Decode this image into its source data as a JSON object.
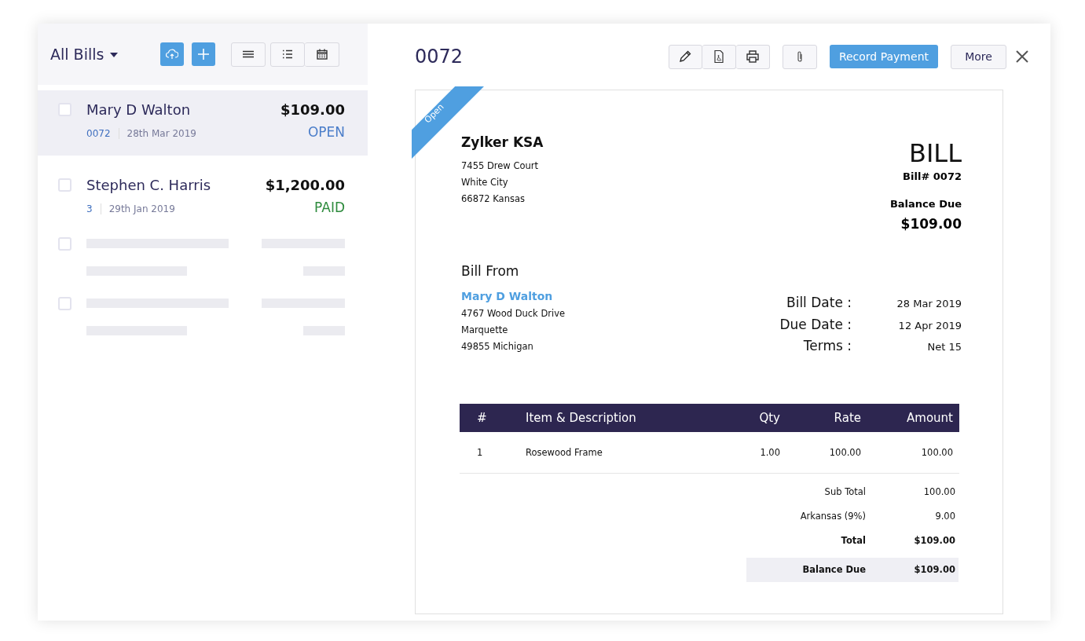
{
  "list_header": {
    "title": "All Bills"
  },
  "bills": [
    {
      "kind": "bill",
      "selected": true,
      "checked": false,
      "name": "Mary D Walton",
      "amount": "$109.00",
      "number": "0072",
      "date": "28th Mar 2019",
      "status": "OPEN",
      "color": "#4a7dc9"
    },
    {
      "kind": "bill",
      "selected": false,
      "checked": false,
      "name": "Stephen C. Harris",
      "amount": "$1,200.00",
      "number": "3",
      "date": "29th Jan 2019",
      "status": "PAID",
      "color": "#2e8b3d"
    },
    {
      "kind": "placeholder",
      "selected": false,
      "checked": false
    },
    {
      "kind": "placeholder",
      "selected": false,
      "checked": false
    }
  ],
  "detail": {
    "title": "0072",
    "record_button": "Record Payment",
    "more_button": "More"
  },
  "document": {
    "ribbon": "Open",
    "company": "Zylker KSA",
    "company_address": [
      "7455 Drew Court",
      "White City",
      "66872 Kansas"
    ],
    "doc_title": "BILL",
    "bill_number": "Bill# 0072",
    "balance_label": "Balance Due",
    "balance": "$109.00",
    "bill_from_label": "Bill From",
    "vendor": "Mary D Walton",
    "vendor_address": [
      "4767 Wood Duck Drive",
      "Marquette",
      "49855 Michigan"
    ],
    "meta": [
      {
        "label": "Bill Date :",
        "value": "28 Mar 2019"
      },
      {
        "label": "Due Date :",
        "value": "12 Apr 2019"
      },
      {
        "label": "Terms :",
        "value": "Net 15"
      }
    ],
    "columns": [
      "#",
      "Item & Description",
      "Qty",
      "Rate",
      "Amount"
    ],
    "rows": [
      [
        "1",
        "Rosewood Frame",
        "1.00",
        "100.00",
        "100.00"
      ]
    ],
    "totals": [
      {
        "label": "Sub Total",
        "value": "100.00",
        "kind": "plain"
      },
      {
        "label": "Arkansas (9%)",
        "value": "9.00",
        "kind": "plain"
      },
      {
        "label": "Total",
        "value": "$109.00",
        "kind": "bold"
      },
      {
        "label": "Balance Due",
        "value": "$109.00",
        "kind": "highlight"
      }
    ]
  }
}
